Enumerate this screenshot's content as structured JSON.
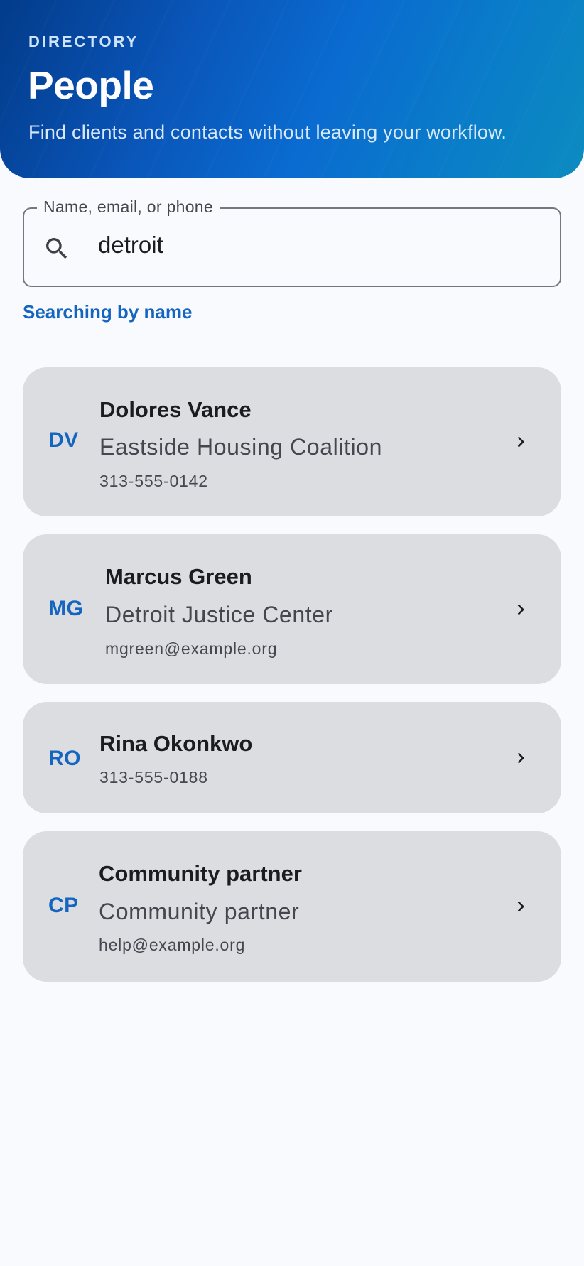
{
  "header": {
    "overline": "DIRECTORY",
    "title": "People",
    "subtitle": "Find clients and contacts without leaving your workflow."
  },
  "search": {
    "label": "Name, email, or phone",
    "value": "detroit",
    "helper": "Searching by name",
    "icon": "search-icon"
  },
  "results": [
    {
      "initials": "DV",
      "name": "Dolores Vance",
      "organization": "Eastside Housing Coalition",
      "detail": "313-555-0142"
    },
    {
      "initials": "MG",
      "name": "Marcus Green",
      "organization": "Detroit Justice Center",
      "detail": "mgreen@example.org"
    },
    {
      "initials": "RO",
      "name": "Rina Okonkwo",
      "detail": "313-555-0188"
    },
    {
      "initials": "CP",
      "name": "Community partner",
      "organization": "Community partner",
      "detail": "help@example.org"
    }
  ],
  "colors": {
    "accent": "#1565c0",
    "card": "#dcdde1",
    "background": "#f8fafd"
  }
}
